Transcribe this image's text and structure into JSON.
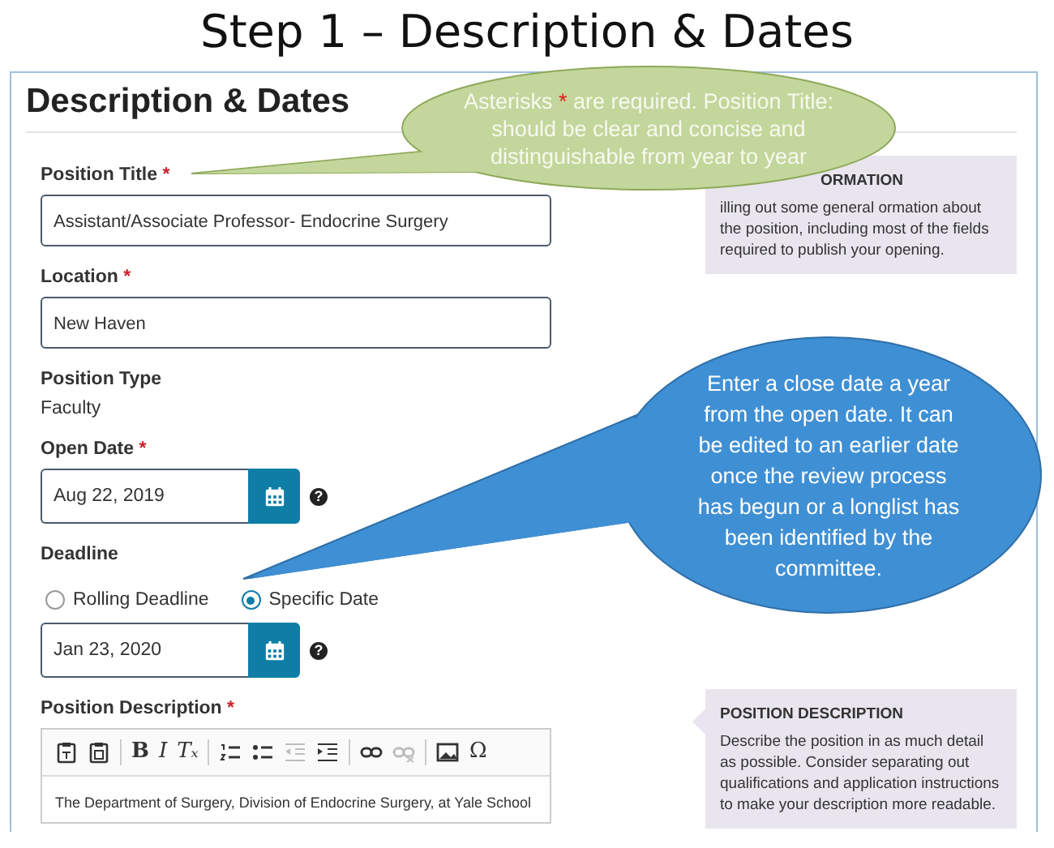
{
  "slide_title": "Step 1 – Description & Dates",
  "section_title": "Description & Dates",
  "fields": [
    {
      "kind": "text",
      "label": "Position Title",
      "required_mark": "*",
      "value": "Assistant/Associate Professor- Endocrine Surgery"
    },
    {
      "kind": "text",
      "label": "Location",
      "required_mark": "*",
      "value": "New Haven"
    },
    {
      "kind": "static",
      "label": "Position Type",
      "value": "Faculty"
    },
    {
      "kind": "date",
      "label": "Open Date",
      "required_mark": "*",
      "value": "Aug 22, 2019",
      "help": "?"
    },
    {
      "kind": "radio-date",
      "label": "Deadline",
      "options": [
        {
          "label": "Rolling Deadline",
          "selected": false
        },
        {
          "label": "Specific Date",
          "selected": true
        }
      ],
      "value": "Jan 23, 2020",
      "help": "?"
    },
    {
      "kind": "editor",
      "label": "Position Description",
      "required_mark": "*",
      "toolbar": [
        {
          "kind": "paste",
          "disabled": false
        },
        {
          "kind": "paste-text",
          "disabled": false
        },
        {
          "kind": "sep"
        },
        {
          "kind": "bold",
          "label": "B",
          "disabled": false
        },
        {
          "kind": "italic",
          "label": "I",
          "disabled": false
        },
        {
          "kind": "clear-format",
          "label": "Tₓ",
          "disabled": false
        },
        {
          "kind": "sep"
        },
        {
          "kind": "numbered-list",
          "disabled": false
        },
        {
          "kind": "bullet-list",
          "disabled": false
        },
        {
          "kind": "outdent",
          "disabled": true
        },
        {
          "kind": "indent",
          "disabled": false
        },
        {
          "kind": "sep"
        },
        {
          "kind": "link",
          "disabled": false
        },
        {
          "kind": "unlink",
          "disabled": true
        },
        {
          "kind": "sep"
        },
        {
          "kind": "image",
          "disabled": false
        },
        {
          "kind": "special-char",
          "label": "Ω",
          "disabled": false
        }
      ],
      "value": "The Department of Surgery, Division of Endocrine Surgery, at Yale School"
    }
  ],
  "info_boxes": [
    {
      "title": "ORMATION",
      "text": "illing out some general ormation about the position, including most of the fields required to publish your opening.",
      "partly_covered": true
    },
    {
      "title": "POSITION DESCRIPTION",
      "text": "Describe the position in as much detail as possible. Consider separating out qualifications and application instructions to make your description more readable.",
      "partly_covered": false
    }
  ],
  "callouts": [
    {
      "kind": "green",
      "segments": [
        {
          "text": "Asterisks ",
          "highlight": false
        },
        {
          "text": "*",
          "highlight": true
        },
        {
          "text": " are required. Position Title: should be clear and concise and distinguishable from year to year",
          "highlight": false
        }
      ]
    },
    {
      "kind": "blue",
      "segments": [
        {
          "text": "Enter a close date a year from the open date.  It can be edited to an earlier date once the review process has begun or a longlist has been identified by the committee.",
          "highlight": false
        }
      ]
    }
  ]
}
